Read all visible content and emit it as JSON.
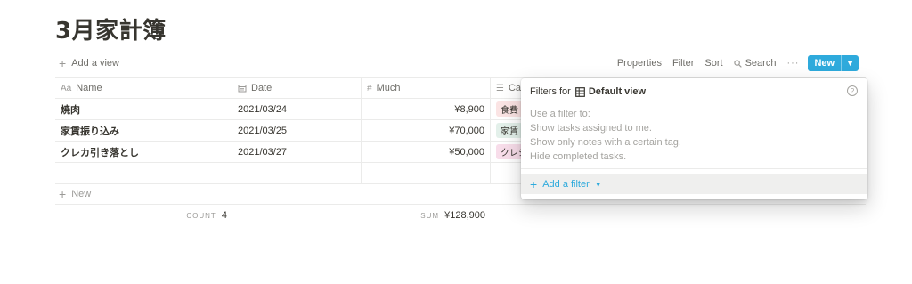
{
  "page": {
    "title": "3月家計簿"
  },
  "toolbar": {
    "add_view": "Add a view",
    "properties": "Properties",
    "filter": "Filter",
    "sort": "Sort",
    "search": "Search",
    "more": "···",
    "new": "New"
  },
  "table": {
    "headers": {
      "name": "Name",
      "date": "Date",
      "much": "Much",
      "category": "Cat"
    },
    "rows": [
      {
        "name": "焼肉",
        "date": "2021/03/24",
        "much": "¥8,900",
        "category": "食費"
      },
      {
        "name": "家賃振り込み",
        "date": "2021/03/25",
        "much": "¥70,000",
        "category": "家賃"
      },
      {
        "name": "クレカ引き落とし",
        "date": "2021/03/27",
        "much": "¥50,000",
        "category": "クレジ"
      }
    ],
    "new_row": "New",
    "calc": {
      "count_label": "COUNT",
      "count_value": "4",
      "sum_label": "SUM",
      "sum_value": "¥128,900"
    }
  },
  "filter_popup": {
    "title": "Filters for",
    "view_name": "Default view",
    "hints": [
      "Use a filter to:",
      "Show tasks assigned to me.",
      "Show only notes with a certain tag.",
      "Hide completed tasks."
    ],
    "add_filter": "Add a filter"
  },
  "colors": {
    "accent": "#2eaadc",
    "tag_food": "#fbe4e4",
    "tag_rent": "#e3f0ea",
    "tag_credit": "#f8ddea"
  }
}
